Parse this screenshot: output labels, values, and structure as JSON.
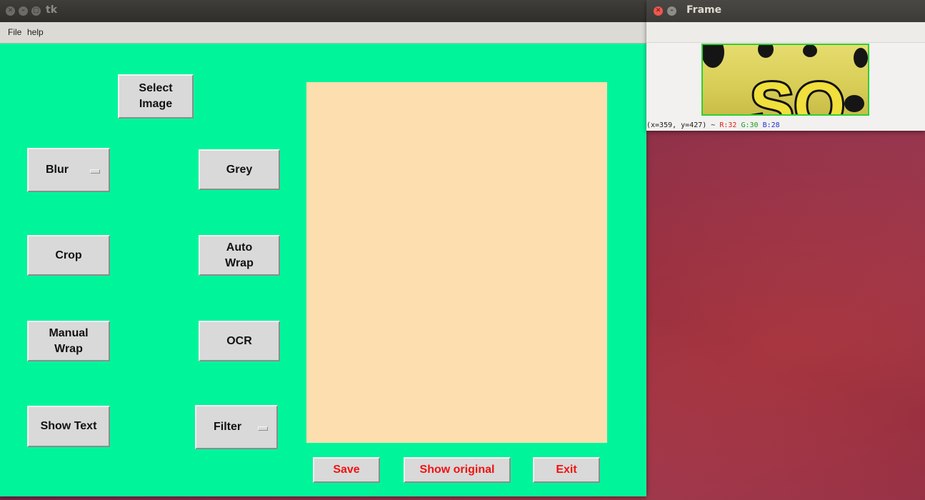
{
  "tk_window": {
    "title": "tk",
    "menu": [
      "File",
      "help"
    ],
    "buttons": {
      "select_image": [
        "Select",
        "Image"
      ],
      "blur": "Blur",
      "grey": "Grey",
      "crop": "Crop",
      "auto_wrap": [
        "Auto",
        "Wrap"
      ],
      "manual_wrap": [
        "Manual",
        "Wrap"
      ],
      "ocr": "OCR",
      "show_text": "Show Text",
      "filter": "Filter",
      "save": "Save",
      "show_original": "Show original",
      "exit": "Exit"
    },
    "colors": {
      "background": "#00f59b",
      "canvas": "#fddeae",
      "action_text": "#ef1313"
    }
  },
  "frame_window": {
    "title": "Frame",
    "status": {
      "coords": "(x=359, y=427) ~",
      "r": "R:32",
      "g": "G:30",
      "b": "B:28"
    }
  }
}
